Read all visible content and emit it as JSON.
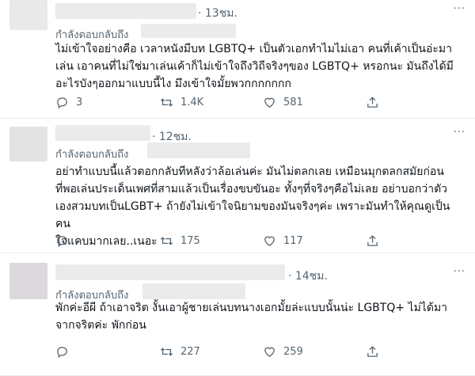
{
  "tweets": [
    {
      "time": "· 13ชม.",
      "replying_to": "กำลังตอบกลับถึง",
      "lines": [
        "ไม่เข้าใจอย่างคือ เวลาหนังมีบท LGBTQ+ เป็นตัวเอกทำไมไม่เอา คนที่เค้าเป็นอ่ะมา",
        "เล่น เอาคนที่ไม่ใช่มาเล่นเค้าก็ไม่เข้าใจถึงวิถีจริงๆของ LGBTQ+ หรอกนะ มันถึงได้มี",
        "อะไรบังๆออกมาแบบนี้ไง มึงเข้าใจมั้ยพวกกกกกกก"
      ],
      "replies": "3",
      "retweets": "1.4K",
      "likes": "581"
    },
    {
      "time": "· 12ชม.",
      "replying_to": "กำลังตอบกลับถึง",
      "lines": [
        "อย่าทำแบบนี้แล้วตอกกลับทีหลังว่าล้อเล่นค่ะ มันไม่ตลกเลย เหมือนมุกตลกสมัยก่อน",
        "ที่พอเล่นประเด็นเพศที่สามแล้วเป็นเรื่องขบขันอะ ทั้งๆที่จริงๆคือไม่เลย อย่าบอกว่าตัว",
        "เองสวมบทเป็นLGBT+ ถ้ายังไม่เข้าใจนิยามของมันจริงๆค่ะ เพราะมันทำให้คุณดูเป็นคน",
        "ใจแคบมากเลย..เนอะ"
      ],
      "replies": "",
      "retweets": "175",
      "likes": "117"
    },
    {
      "time": "· 14ชม.",
      "replying_to": "กำลังตอบกลับถึง",
      "lines": [
        "พักค่ะอีผี ถ้าเอาจริต งั้นเอาผู้ชายเล่นบทนางเอกมั้ยล่ะแบบนั้นน่ะ LGBTQ+ ไม่ได้มา",
        "จากจริตค่ะ พักก่อน"
      ],
      "replies": "",
      "retweets": "227",
      "likes": "259"
    }
  ],
  "colors": {
    "text": "#0f1419",
    "muted": "#536471",
    "divider": "#e6ecf0"
  },
  "icons": [
    "reply-icon",
    "retweet-icon",
    "like-icon",
    "share-icon",
    "more-icon"
  ]
}
